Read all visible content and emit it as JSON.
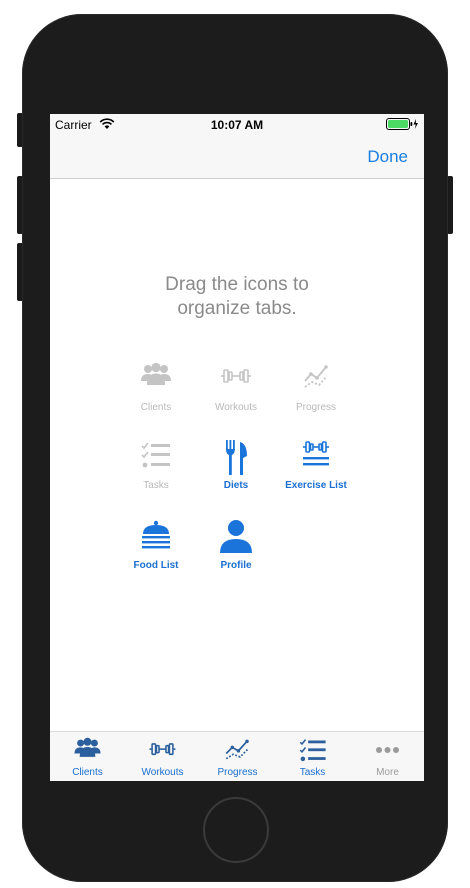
{
  "status_bar": {
    "carrier": "Carrier",
    "time": "10:07 AM",
    "wifi_icon": "wifi-icon",
    "battery_icon": "battery-charging-icon",
    "battery_color": "#4cd964"
  },
  "nav_bar": {
    "done_label": "Done"
  },
  "instructions": {
    "line1": "Drag the icons to",
    "line2": "organize tabs."
  },
  "colors": {
    "accent": "#1a7de0",
    "enabled_icon": "#1a74d9",
    "disabled_icon": "#c4c4c4",
    "tab_icon_active": "#2c5f9e",
    "tab_icon_inactive": "#9a9a9a"
  },
  "customize_items": [
    {
      "label": "Clients",
      "icon": "users-icon",
      "enabled": false
    },
    {
      "label": "Workouts",
      "icon": "dumbbell-icon",
      "enabled": false
    },
    {
      "label": "Progress",
      "icon": "line-chart-icon",
      "enabled": false
    },
    {
      "label": "Tasks",
      "icon": "checklist-icon",
      "enabled": false
    },
    {
      "label": "Diets",
      "icon": "fork-knife-icon",
      "enabled": true
    },
    {
      "label": "Exercise List",
      "icon": "dumbbell-list-icon",
      "enabled": true
    },
    {
      "label": "Food List",
      "icon": "food-cloche-icon",
      "enabled": true
    },
    {
      "label": "Profile",
      "icon": "person-icon",
      "enabled": true
    }
  ],
  "tab_bar": [
    {
      "label": "Clients",
      "icon": "users-icon",
      "active": true
    },
    {
      "label": "Workouts",
      "icon": "dumbbell-icon",
      "active": true
    },
    {
      "label": "Progress",
      "icon": "line-chart-icon",
      "active": true
    },
    {
      "label": "Tasks",
      "icon": "checklist-icon",
      "active": true
    },
    {
      "label": "More",
      "icon": "more-dots-icon",
      "active": false
    }
  ]
}
